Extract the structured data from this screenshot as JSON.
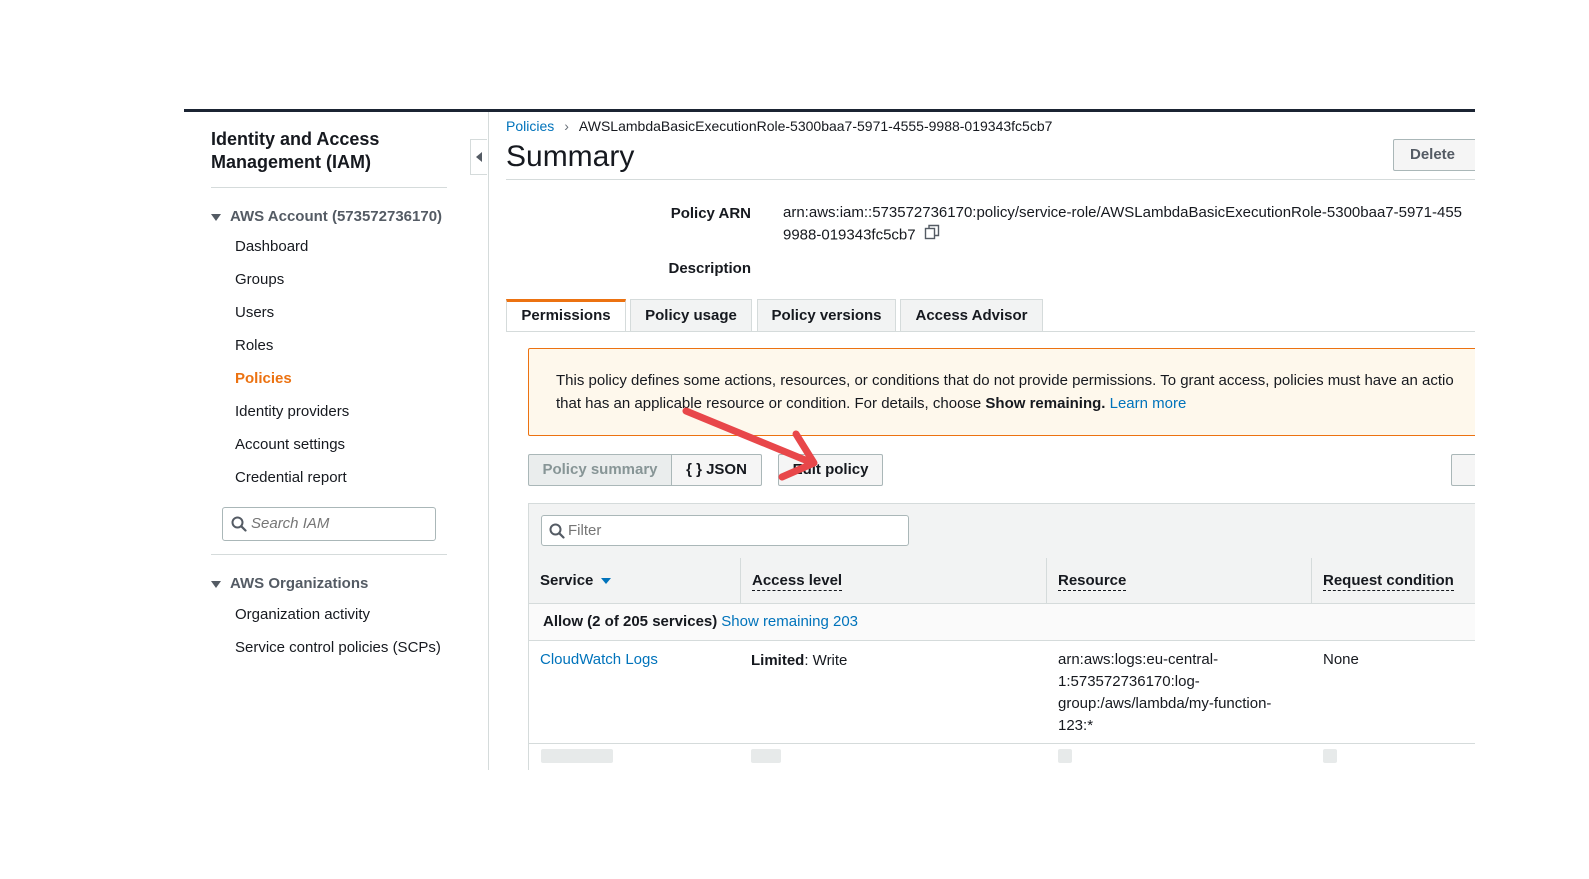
{
  "sidebar": {
    "title": "Identity and Access Management (IAM)",
    "account_group": "AWS Account (573572736170)",
    "items": [
      {
        "label": "Dashboard"
      },
      {
        "label": "Groups"
      },
      {
        "label": "Users"
      },
      {
        "label": "Roles"
      },
      {
        "label": "Policies",
        "active": true
      },
      {
        "label": "Identity providers"
      },
      {
        "label": "Account settings"
      },
      {
        "label": "Credential report"
      }
    ],
    "search_placeholder": "Search IAM",
    "org_group": "AWS Organizations",
    "org_items": [
      {
        "label": "Organization activity"
      },
      {
        "label": "Service control policies (SCPs)"
      }
    ]
  },
  "breadcrumb": {
    "parent": "Policies",
    "separator": "›",
    "current": "AWSLambdaBasicExecutionRole-5300baa7-5971-4555-9988-019343fc5cb7"
  },
  "page": {
    "title": "Summary",
    "delete_label": "Delete"
  },
  "details": {
    "policy_arn_label": "Policy ARN",
    "policy_arn_line1": "arn:aws:iam::573572736170:policy/service-role/AWSLambdaBasicExecutionRole-5300baa7-5971-455",
    "policy_arn_line2": "9988-019343fc5cb7",
    "description_label": "Description"
  },
  "tabs": [
    {
      "label": "Permissions",
      "active": true
    },
    {
      "label": "Policy usage"
    },
    {
      "label": "Policy versions"
    },
    {
      "label": "Access Advisor"
    }
  ],
  "alert": {
    "line1": "This policy defines some actions, resources, or conditions that do not provide permissions. To grant access, policies must have an actio",
    "line2_prefix": "that has an applicable resource or condition. For details, choose ",
    "line2_bold": "Show remaining.",
    "link": "Learn more"
  },
  "buttons": {
    "policy_summary": "Policy summary",
    "json": "{ } JSON",
    "edit_policy": "Edit policy"
  },
  "table": {
    "filter_placeholder": "Filter",
    "columns": [
      "Service",
      "Access level",
      "Resource",
      "Request condition"
    ],
    "group_label": "Allow (2 of 205 services)",
    "group_link": "Show remaining 203",
    "rows": [
      {
        "service": "CloudWatch Logs",
        "access_level_bold": "Limited",
        "access_level_rest": ": Write",
        "resource_lines": [
          "arn:aws:logs:eu-central-",
          "1:573572736170:log-",
          "group:/aws/lambda/my-function-",
          "123:*"
        ],
        "condition": "None"
      }
    ]
  },
  "colors": {
    "accent": "#ec7211",
    "link": "#0073bb",
    "alert_bg": "#fef8ec",
    "annotation_arrow": "#e8474a"
  }
}
